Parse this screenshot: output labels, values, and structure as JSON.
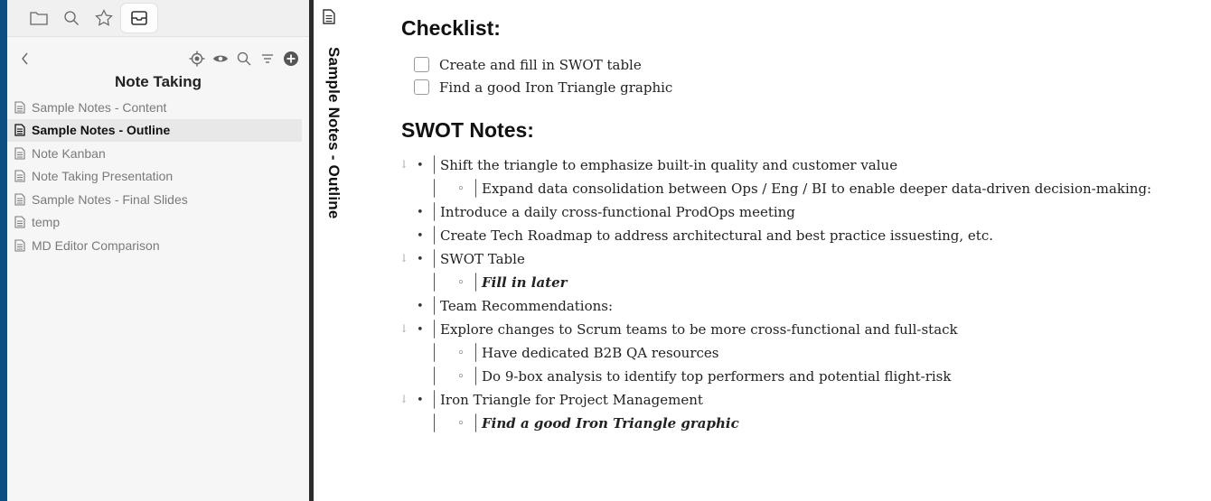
{
  "sidebar": {
    "tabs": [
      "folder-icon",
      "search-icon",
      "star-icon",
      "inbox-icon"
    ],
    "nav_icons": [
      "back-icon",
      "locate-icon",
      "eye-icon",
      "search-icon",
      "filter-icon",
      "add-icon"
    ],
    "folder_title": "Note Taking",
    "files": [
      {
        "label": "Sample Notes - Content"
      },
      {
        "label": "Sample Notes - Outline"
      },
      {
        "label": "Note Kanban"
      },
      {
        "label": "Note Taking Presentation"
      },
      {
        "label": "Sample Notes - Final Slides"
      },
      {
        "label": "temp"
      },
      {
        "label": "MD Editor Comparison"
      }
    ]
  },
  "main": {
    "vertical_title": "Sample Notes - Outline",
    "checklist_heading": "Checklist:",
    "checklist": [
      "Create and fill in SWOT table",
      "Find a good Iron Triangle graphic"
    ],
    "swot_heading": "SWOT Notes:",
    "outline": [
      "Shift the triangle to emphasize built-in quality and customer value",
      "Expand data consolidation between Ops / Eng / BI to enable deeper data-driven decision-making:",
      "Introduce a daily cross-functional ProdOps meeting",
      "Create Tech Roadmap to address architectural and best practice issuesting, etc.",
      "SWOT Table",
      "Fill in later",
      "Team Recommendations:",
      "Explore changes to Scrum teams to be more cross-functional and full-stack",
      "Have dedicated B2B QA resources",
      "Do 9-box analysis to identify top performers and potential flight-risk",
      "Iron Triangle for Project Management",
      "Find a good Iron Triangle graphic"
    ]
  },
  "colors": {
    "window_bg": "#0a4f80",
    "divider": "#2b2b2b",
    "active_file_bg": "#e8e8e8"
  }
}
